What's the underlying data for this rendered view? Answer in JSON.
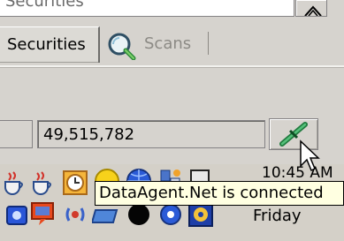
{
  "top": {
    "field_text": "Securities"
  },
  "tabs": {
    "securities_label": "Securities",
    "scans_label": "Scans"
  },
  "status": {
    "value": "49,515,782"
  },
  "tray": {
    "time": "10:45 AM",
    "day": "Friday"
  },
  "tooltip": {
    "text": "DataAgent.Net is connected"
  },
  "icons": {
    "connect": "plug-connector-icon",
    "scans": "magnifier-icon",
    "top_button": "chevron-icon"
  }
}
